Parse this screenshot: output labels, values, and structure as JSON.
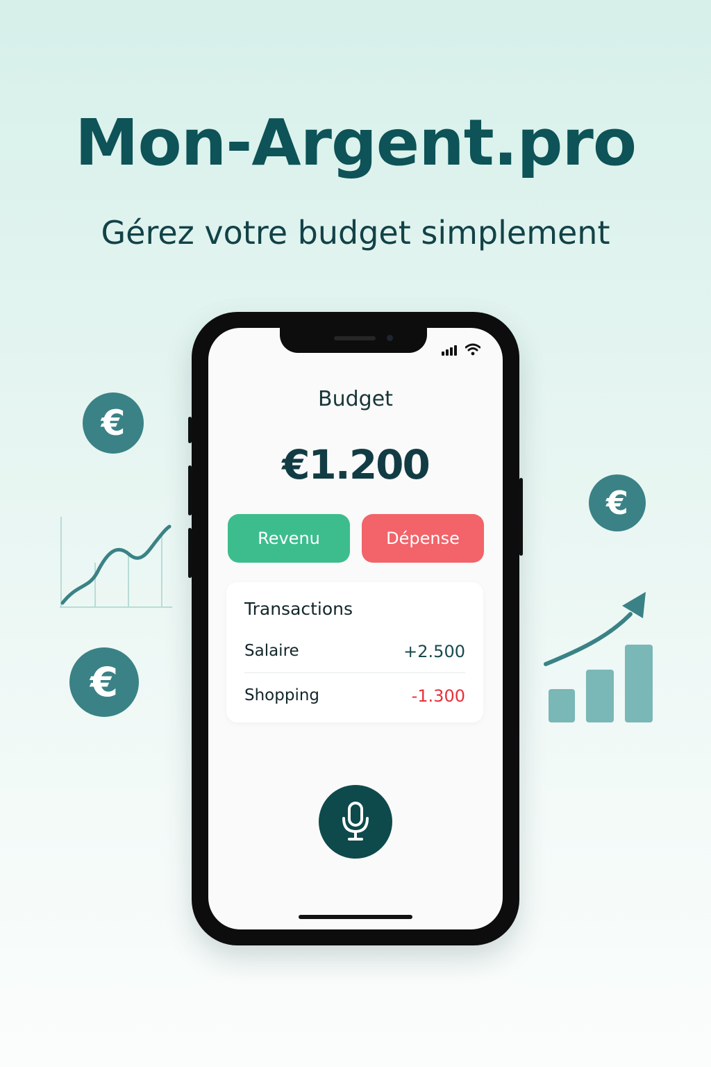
{
  "header": {
    "title": "Mon-Argent.pro",
    "tagline": "Gérez votre budget simplement"
  },
  "decorations": {
    "euro_symbol": "€",
    "accent_color": "#3a8286"
  },
  "phone": {
    "status_icons": [
      "signal-icon",
      "wifi-icon"
    ],
    "budget_label": "Budget",
    "balance": "€1.200",
    "buttons": {
      "income_label": "Revenu",
      "expense_label": "Dépense"
    },
    "transactions": {
      "title": "Transactions",
      "items": [
        {
          "name": "Salaire",
          "amount": "+2.500"
        },
        {
          "name": "Shopping",
          "amount": "-1.300"
        }
      ]
    },
    "mic_icon": "microphone-icon"
  },
  "colors": {
    "primary": "#0d5358",
    "income": "#3dbd8e",
    "expense": "#f2636a",
    "negative_amount": "#e8303a"
  }
}
